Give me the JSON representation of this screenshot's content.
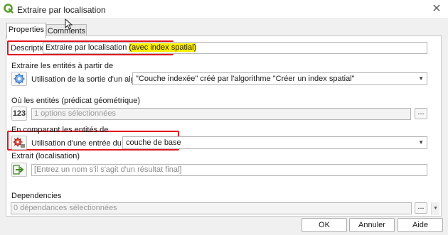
{
  "window": {
    "title": "Extraire par localisation",
    "close_glyph": "✕"
  },
  "tabs": [
    {
      "label": "Properties",
      "active": true
    },
    {
      "label": "Comments",
      "active": false
    }
  ],
  "description": {
    "label": "Description",
    "value_main": "Extraire par localisation",
    "value_highlight": "(avec index spatial)"
  },
  "extract_from": {
    "label": "Extraire les entités à partir de",
    "mode_label": "Utilisation de la sortie d'un algorithme",
    "icon": "algorithm-output-icon",
    "selected": "\"Couche indexée\" créé par l'algorithme \"Créer un index spatial\""
  },
  "predicate": {
    "label": "Où les entités (prédicat géométrique)",
    "icon": "number-123-icon",
    "icon_text": "123",
    "value": "1 options sélectionnées",
    "button": "..."
  },
  "compare": {
    "label": "En comparant les entités de",
    "mode_label": "Utilisation d'une entrée du modèle",
    "icon": "model-input-icon",
    "selected": "couche de base"
  },
  "output": {
    "label": "Extrait (localisation)",
    "icon": "output-arrow-icon",
    "placeholder": "[Entrez un nom s'il s'agit d'un résultat final]"
  },
  "dependencies": {
    "label": "Dependencies",
    "value": "0 dépendances sélectionnées",
    "button": "..."
  },
  "buttons": {
    "ok": "OK",
    "cancel": "Annuler",
    "help": "Aide"
  },
  "colors": {
    "highlight_box": "#e5141e",
    "highlight_text": "#ffef00",
    "qgis_green": "#5b9e2b"
  }
}
